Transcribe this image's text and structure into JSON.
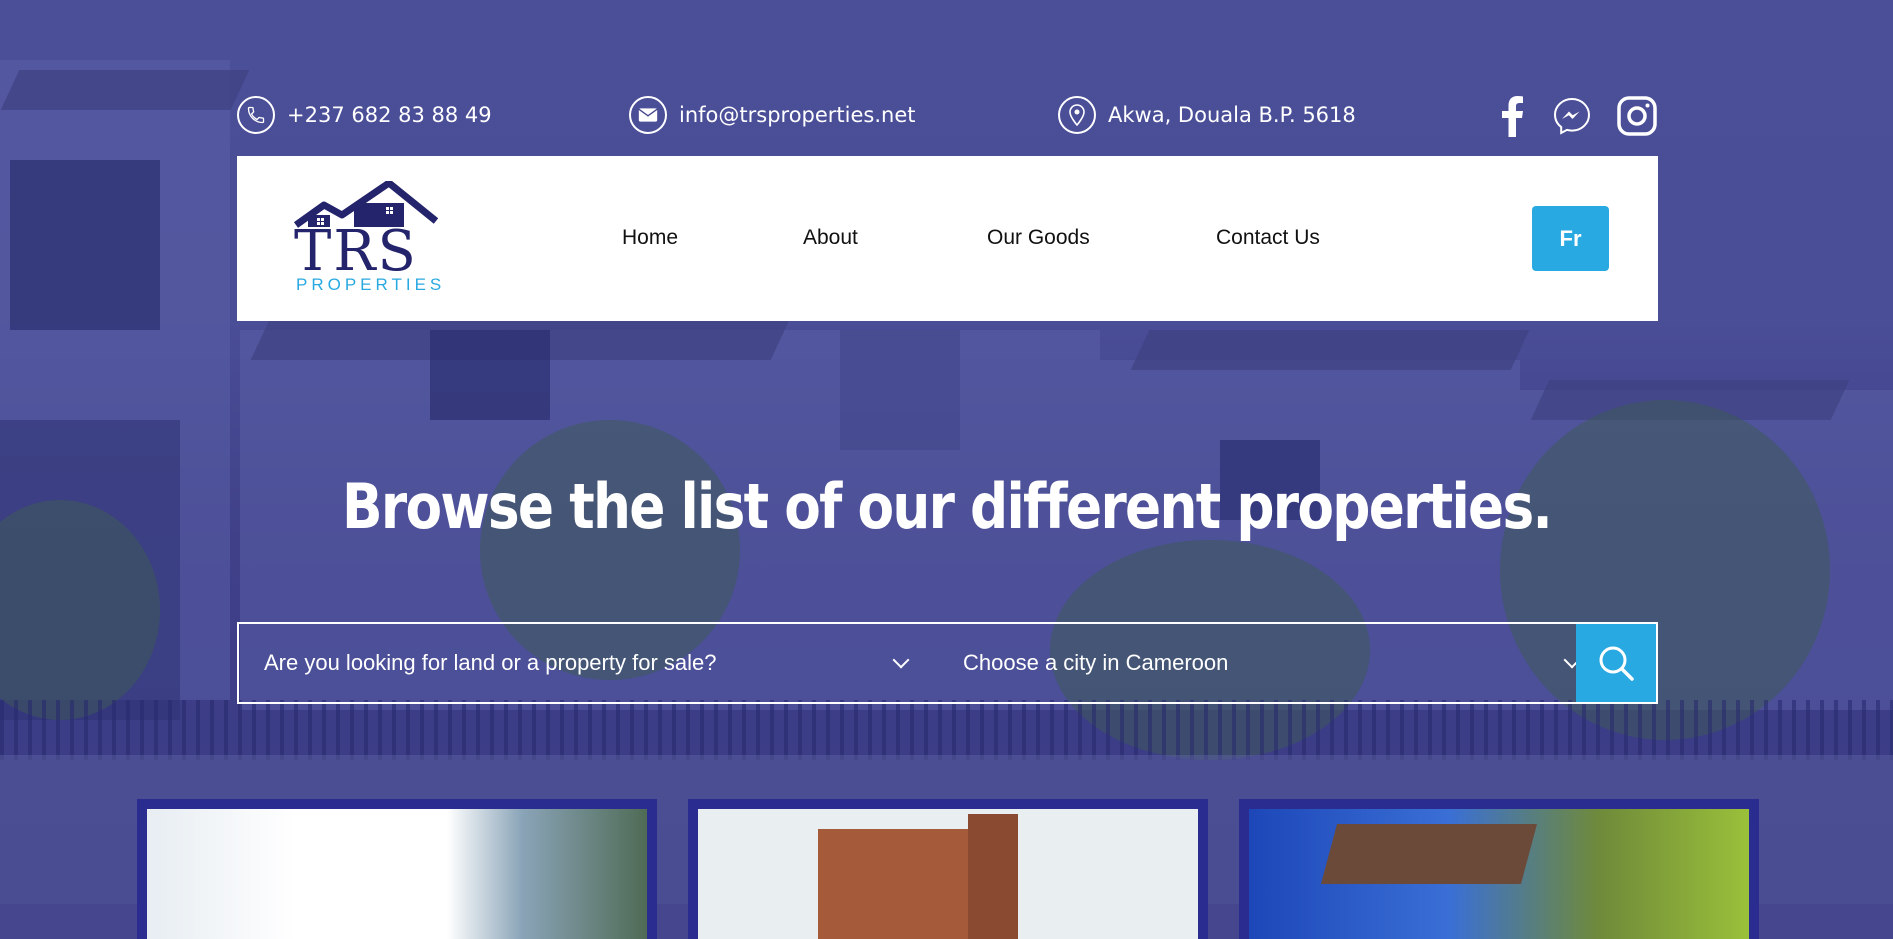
{
  "contact": {
    "phone": "+237 682 83 88 49",
    "email": "info@trsproperties.net",
    "address": "Akwa, Douala B.P. 5618"
  },
  "social": {
    "facebook_icon": "facebook-icon",
    "messenger_icon": "messenger-icon",
    "instagram_icon": "instagram-icon"
  },
  "logo": {
    "main": "TRS",
    "sub": "PROPERTIES"
  },
  "nav": {
    "home": "Home",
    "about": "About",
    "our_goods": "Our Goods",
    "contact_us": "Contact Us",
    "lang": "Fr"
  },
  "hero": {
    "headline": "Browse the list of our different properties."
  },
  "search": {
    "type_select": "Are you looking for land or a property for sale?",
    "city_select": "Choose a city in Cameroon",
    "button_icon": "search-icon"
  },
  "colors": {
    "accent": "#29a9e1",
    "brand": "#23246b",
    "card_frame": "#2a2d8f"
  }
}
